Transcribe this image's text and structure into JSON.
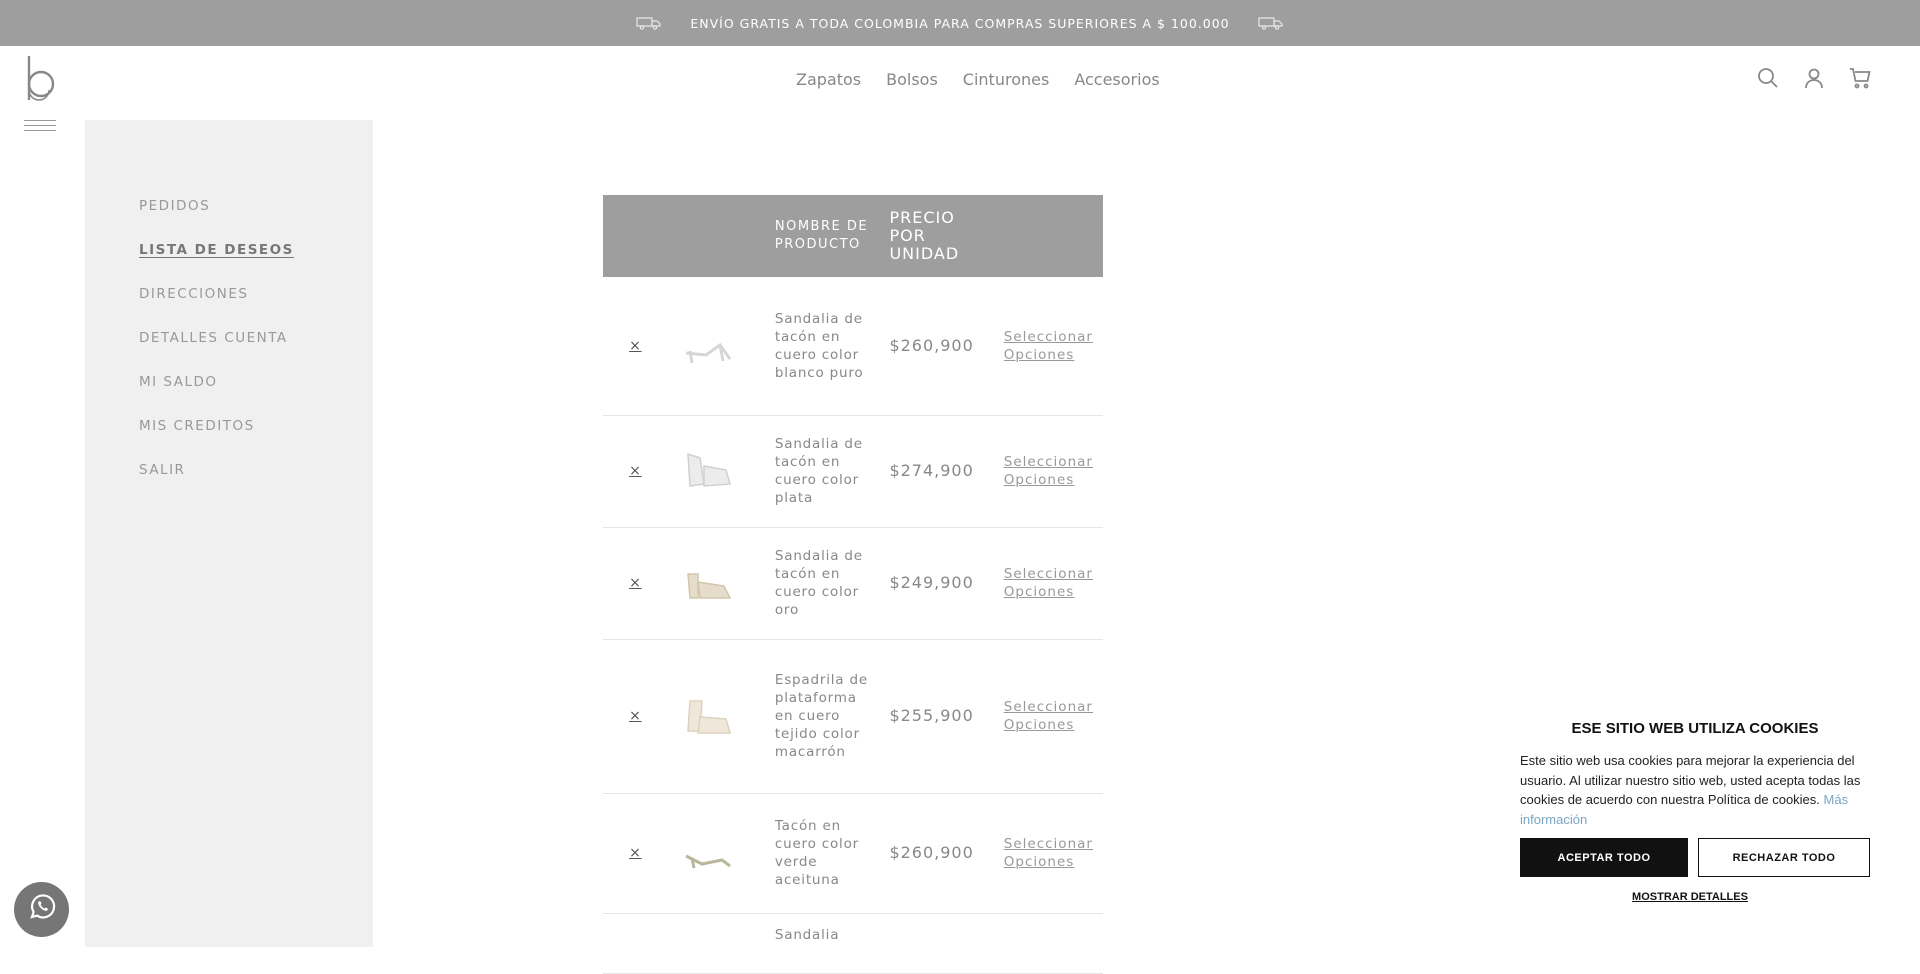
{
  "topbar": {
    "promo": "ENVÍO GRATIS A TODA COLOMBIA PARA COMPRAS SUPERIORES A $ 100.000"
  },
  "nav": {
    "items": [
      "Zapatos",
      "Bolsos",
      "Cinturones",
      "Accesorios"
    ]
  },
  "sidebar": {
    "items": [
      {
        "label": "PEDIDOS"
      },
      {
        "label": "LISTA DE DESEOS"
      },
      {
        "label": "DIRECCIONES"
      },
      {
        "label": "DETALLES CUENTA"
      },
      {
        "label": "MI SALDO"
      },
      {
        "label": "MIS CREDITOS"
      },
      {
        "label": "SALIR"
      }
    ],
    "active_index": 1
  },
  "table": {
    "headers": {
      "name": "NOMBRE DE PRODUCTO",
      "price": "PRECIO POR UNIDAD"
    },
    "rows": [
      {
        "remove": "×",
        "name": "Sandalia de tacón en cuero color blanco puro",
        "price": "$260,900",
        "action": "Seleccionar Opciones",
        "thumb": "white-sandal"
      },
      {
        "remove": "×",
        "name": "Sandalia de tacón en cuero color plata",
        "price": "$274,900",
        "action": "Seleccionar Opciones",
        "thumb": "silver-platform"
      },
      {
        "remove": "×",
        "name": "Sandalia de tacón en cuero color oro",
        "price": "$249,900",
        "action": "Seleccionar Opciones",
        "thumb": "gold-sandal"
      },
      {
        "remove": "×",
        "name": "Espadrila de plataforma en cuero tejido color macarrón",
        "price": "$255,900",
        "action": "Seleccionar Opciones",
        "thumb": "espadrille"
      },
      {
        "remove": "×",
        "name": "Tacón en cuero color verde aceituna",
        "price": "$260,900",
        "action": "Seleccionar Opciones",
        "thumb": "green-heel"
      },
      {
        "remove": "",
        "name": "Sandalia",
        "price": "",
        "action": "",
        "thumb": ""
      }
    ]
  },
  "cookie": {
    "title": "ESE SITIO WEB UTILIZA COOKIES",
    "text": "Este sitio web usa cookies para mejorar la experiencia del usuario. Al utilizar nuestro sitio web, usted acepta todas las cookies de acuerdo con nuestra Política de cookies.",
    "more": "Más información",
    "accept": "ACEPTAR TODO",
    "reject": "RECHAZAR TODO",
    "details": "MOSTRAR DETALLES"
  },
  "colors": {
    "topbar": "#9e9e9e",
    "sidebar": "#f0f0f0",
    "table_header": "#9e9e9e",
    "whatsapp": "#767676"
  }
}
